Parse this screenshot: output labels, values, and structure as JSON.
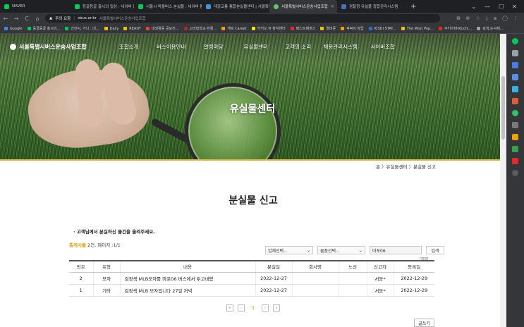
{
  "browser": {
    "tabs": [
      {
        "label": "NAVER",
        "color": "#03c75a",
        "active": false
      },
      {
        "label": "등골등골 홍시의 일상 : 네이버 블로그",
        "color": "#03c75a",
        "active": false
      },
      {
        "label": "서울시 마을버스 분실물 : 네이버 통",
        "color": "#03c75a",
        "active": false
      },
      {
        "label": "대중교통 통합분실물센터 | 서울특별",
        "color": "#4a90d9",
        "active": false
      },
      {
        "label": "서울특별시버스운송사업조합",
        "color": "#6fbf73",
        "active": true
      },
      {
        "label": "경찰청 유실물 종합관리시스템",
        "color": "#4a6fb5",
        "active": false
      }
    ],
    "new_tab": "+",
    "window_controls": [
      "⌄",
      "—",
      "☐",
      "✕"
    ],
    "nav": {
      "back": "←",
      "forward": "→",
      "reload": "C",
      "home": "⌂"
    },
    "security_warning": "주의 요함",
    "url": "sbus.or.kr",
    "page_title_in_bar": "서울특별시버스운송사업조합",
    "bookmarks": [
      {
        "label": "Google",
        "color": "#4285f4"
      },
      {
        "label": "등골등골 홍시의...",
        "color": "#03c75a"
      },
      {
        "label": "건진씨, 가니 : 네...",
        "color": "#03c75a"
      },
      {
        "label": "Daily",
        "color": "#f0c000"
      },
      {
        "label": "READY",
        "color": "#f0c000"
      },
      {
        "label": "대외활동 공모전...",
        "color": "#e0472b"
      },
      {
        "label": "고려대학교-한활...",
        "color": "#b3262b"
      },
      {
        "label": "캐릿 Careet",
        "color": "#f0a000"
      },
      {
        "label": "커커오 뷰 창작센터",
        "color": "#f7e600"
      },
      {
        "label": "패스트캠퍼스",
        "color": "#e02b2b"
      },
      {
        "label": "열비쥰",
        "color": "#f0c000"
      },
      {
        "label": "픽픽이 창립",
        "color": "#f0a000"
      },
      {
        "label": "KISDI STAT...",
        "color": "#2b6fd9"
      },
      {
        "label": "The Most Pop...",
        "color": "#f0c000"
      },
      {
        "label": "쿠키이버(KUchi...",
        "color": "#e02b2b"
      },
      {
        "label": "검색:논씨체...",
        "color": "#9aa0a6"
      }
    ]
  },
  "site": {
    "logo": "서울특별시버스운송사업조합",
    "menu": [
      "조합소개",
      "버스이용안내",
      "알림마당",
      "유실물센터",
      "고객의 소리",
      "채용관리시스템",
      "사이버조합"
    ],
    "hero_title": "유실물센터",
    "breadcrumb": "홈 〉유실물센터 〉분실물 신고",
    "page_title": "분실물 신고",
    "notice": "· 고객님께서 분실하신 물건을 올려주세요.",
    "count_label": "총게시물",
    "count_value": "2건",
    "page_info": ", 페이지 :1/1",
    "search": {
      "company_select": "업체선택...",
      "item_select": "물품선택...",
      "keyword": "마포06",
      "button": "검색",
      "tooltip": "검색"
    },
    "table": {
      "headers": [
        "번호",
        "유형",
        "내용",
        "분실일",
        "회사명",
        "노선",
        "신고자",
        "등록일"
      ],
      "rows": [
        [
          "2",
          "모자",
          "검정색 MLB모자를 마포06 버스에서 두고내렸",
          "2022-12-27",
          "",
          "",
          "서동*",
          "2022-12-29"
        ],
        [
          "1",
          "기타",
          "검정색 MLB 모자입니다 27일 저녁",
          "2022-12-27",
          "",
          "",
          "서동*",
          "2022-12-29"
        ]
      ]
    },
    "pager": {
      "first": "«",
      "prev": "‹",
      "current": "1",
      "next": "›",
      "last": "»"
    },
    "write_button": "글쓰기"
  }
}
